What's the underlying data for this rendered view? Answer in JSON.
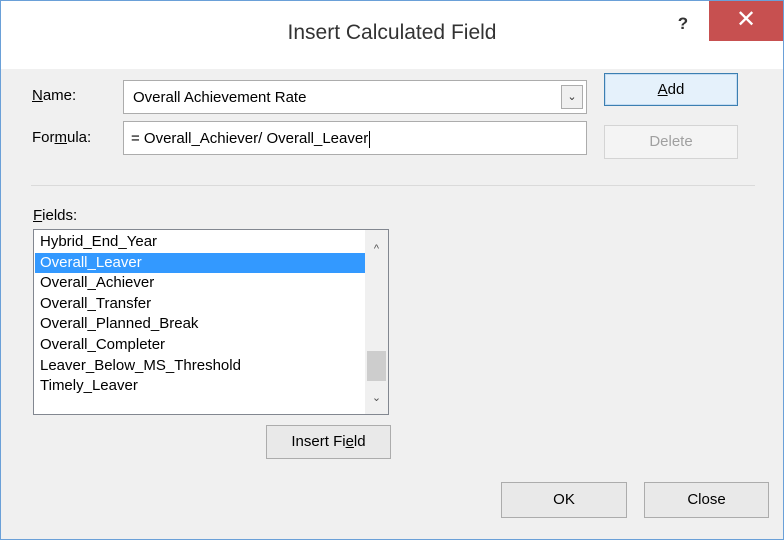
{
  "window": {
    "title": "Insert Calculated Field",
    "help_glyph": "?",
    "close_glyph": "✕"
  },
  "name": {
    "label_u": "N",
    "label_rest": "ame:",
    "value": "Overall Achievement Rate",
    "dropdown_glyph": "⌄"
  },
  "formula": {
    "label_pre": "For",
    "label_u": "m",
    "label_rest": "ula:",
    "value": "= Overall_Achiever/ Overall_Leaver"
  },
  "buttons": {
    "add_u": "A",
    "add_rest": "dd",
    "delete": "Delete",
    "insert_pre": "Insert Fi",
    "insert_u": "e",
    "insert_rest": "ld",
    "ok": "OK",
    "close": "Close"
  },
  "fields": {
    "label_u": "F",
    "label_rest": "ields:",
    "items": [
      "Hybrid_End_Year",
      "Overall_Leaver",
      "Overall_Achiever",
      "Overall_Transfer",
      "Overall_Planned_Break",
      "Overall_Completer",
      "Leaver_Below_MS_Threshold",
      "Timely_Leaver"
    ],
    "selected": "Overall_Leaver",
    "scroll_up_glyph": "^",
    "scroll_down_glyph": "⌄"
  }
}
